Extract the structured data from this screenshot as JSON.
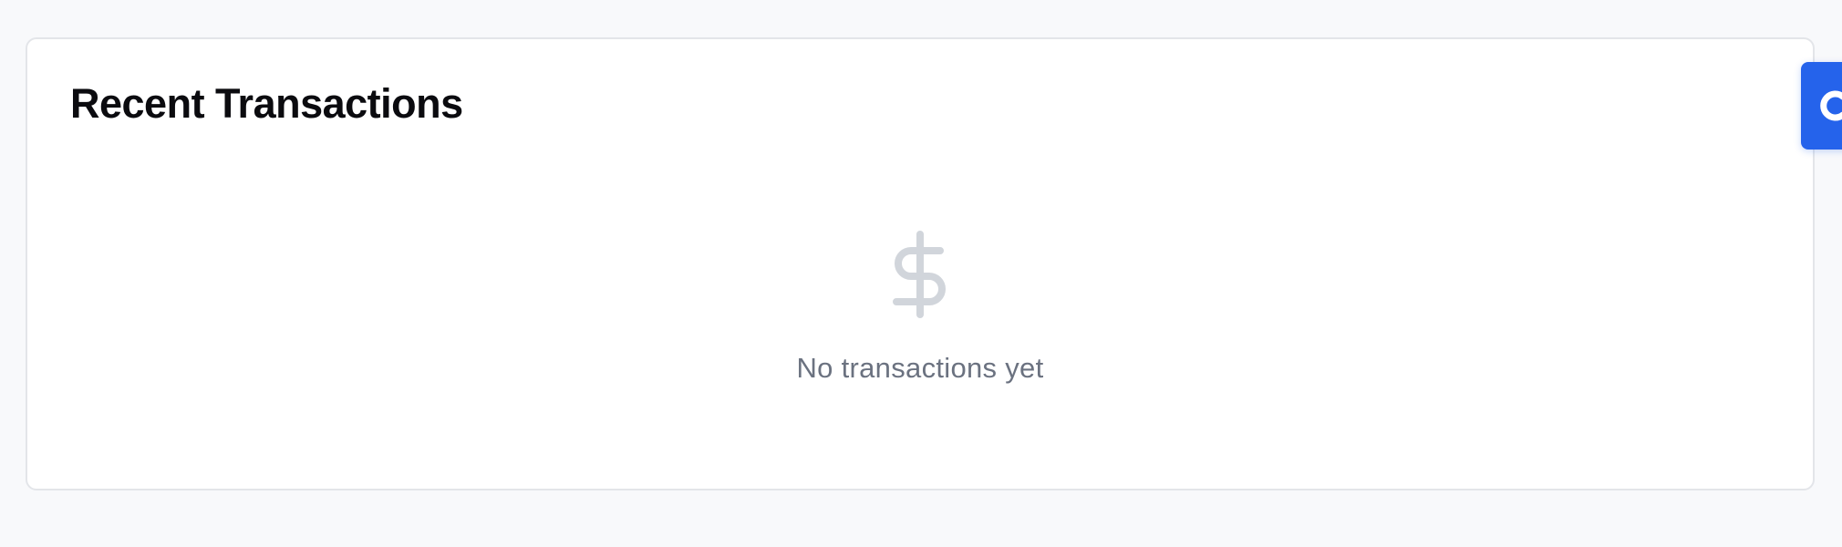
{
  "section": {
    "title": "Recent Transactions"
  },
  "empty_state": {
    "icon": "dollar-icon",
    "message": "No transactions yet"
  },
  "side_tab": {
    "icon": "chat-icon"
  },
  "colors": {
    "accent": "#2563eb",
    "muted_text": "#6b7280",
    "icon_gray": "#d1d5db",
    "card_border": "#e3e5e9",
    "page_background": "#f8f9fb"
  }
}
